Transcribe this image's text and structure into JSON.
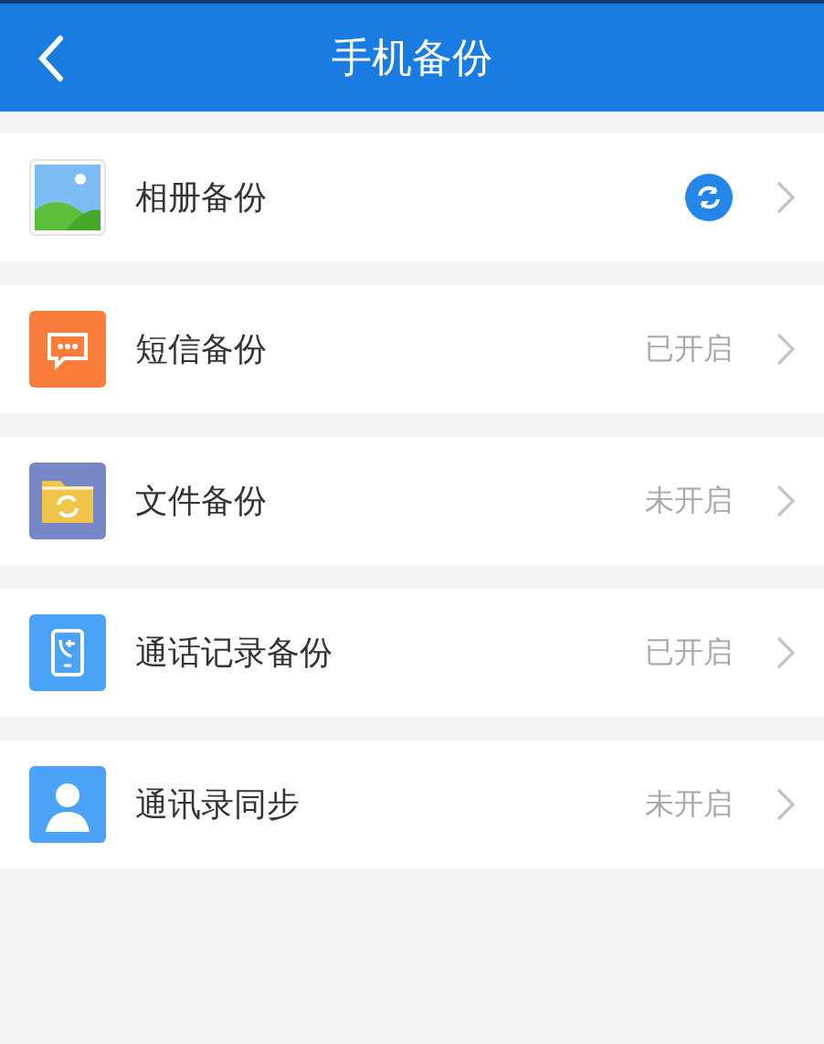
{
  "header": {
    "back_icon": true,
    "title": "手机备份"
  },
  "items": [
    {
      "kind": "photos",
      "label": "相册备份",
      "syncing": true
    },
    {
      "kind": "messages",
      "label": "短信备份",
      "syncing": false,
      "status": "已开启"
    },
    {
      "kind": "files",
      "label": "文件备份",
      "syncing": false,
      "status": "未开启"
    },
    {
      "kind": "calls",
      "label": "通话记录备份",
      "syncing": false,
      "status": "已开启"
    },
    {
      "kind": "contacts",
      "label": "通讯录同步",
      "syncing": false,
      "status": "未开启"
    }
  ]
}
